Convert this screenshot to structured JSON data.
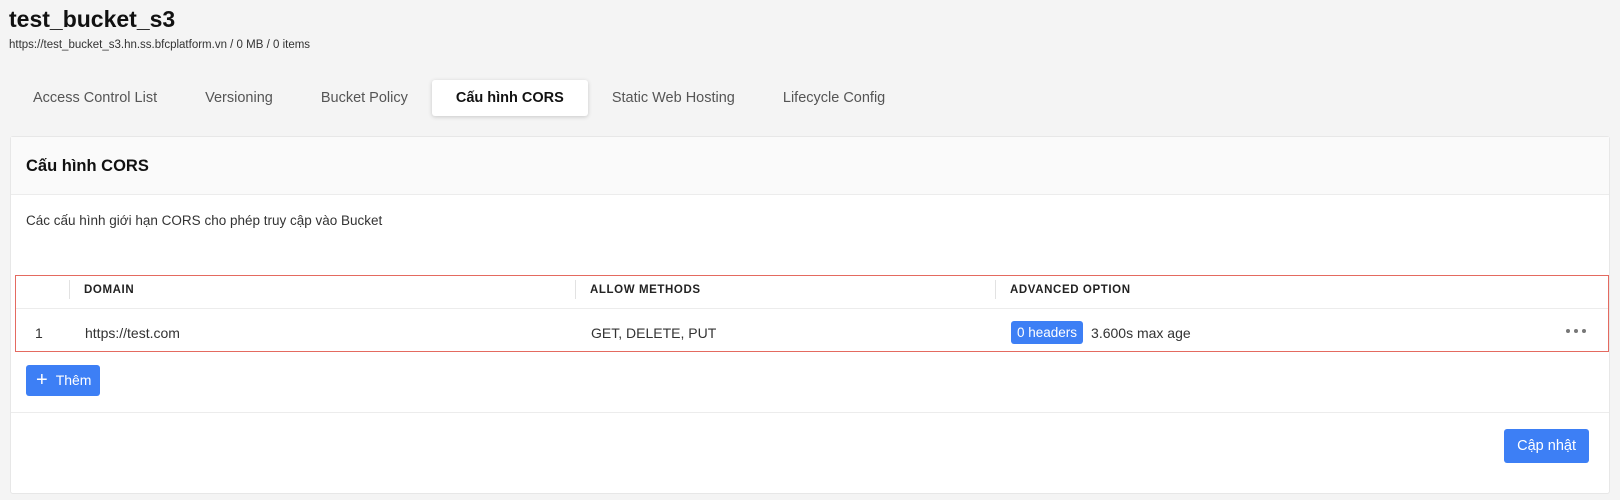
{
  "bucket": {
    "name": "test_bucket_s3",
    "info": "https://test_bucket_s3.hn.ss.bfcplatform.vn / 0 MB / 0 items"
  },
  "tabs": [
    {
      "label": "Access Control List",
      "active": false
    },
    {
      "label": "Versioning",
      "active": false
    },
    {
      "label": "Bucket Policy",
      "active": false
    },
    {
      "label": "Cấu hình CORS",
      "active": true
    },
    {
      "label": "Static Web Hosting",
      "active": false
    },
    {
      "label": "Lifecycle Config",
      "active": false
    }
  ],
  "card": {
    "title": "Cấu hình CORS",
    "description": "Các cấu hình giới hạn CORS cho phép truy cập vào Bucket"
  },
  "table": {
    "columns": [
      "DOMAIN",
      "ALLOW METHODS",
      "ADVANCED OPTION"
    ],
    "rows": [
      {
        "index": "1",
        "domain": "https://test.com",
        "methods": "GET, DELETE, PUT",
        "headers_badge": "0 headers",
        "max_age": "3.600s max age"
      }
    ]
  },
  "buttons": {
    "add": "Thêm",
    "update": "Cập nhật"
  },
  "icons": {
    "add": "plus-icon",
    "row_menu": "more-horizontal-icon"
  },
  "colors": {
    "primary": "#3d7ff5",
    "highlight_border": "#e46a60"
  }
}
